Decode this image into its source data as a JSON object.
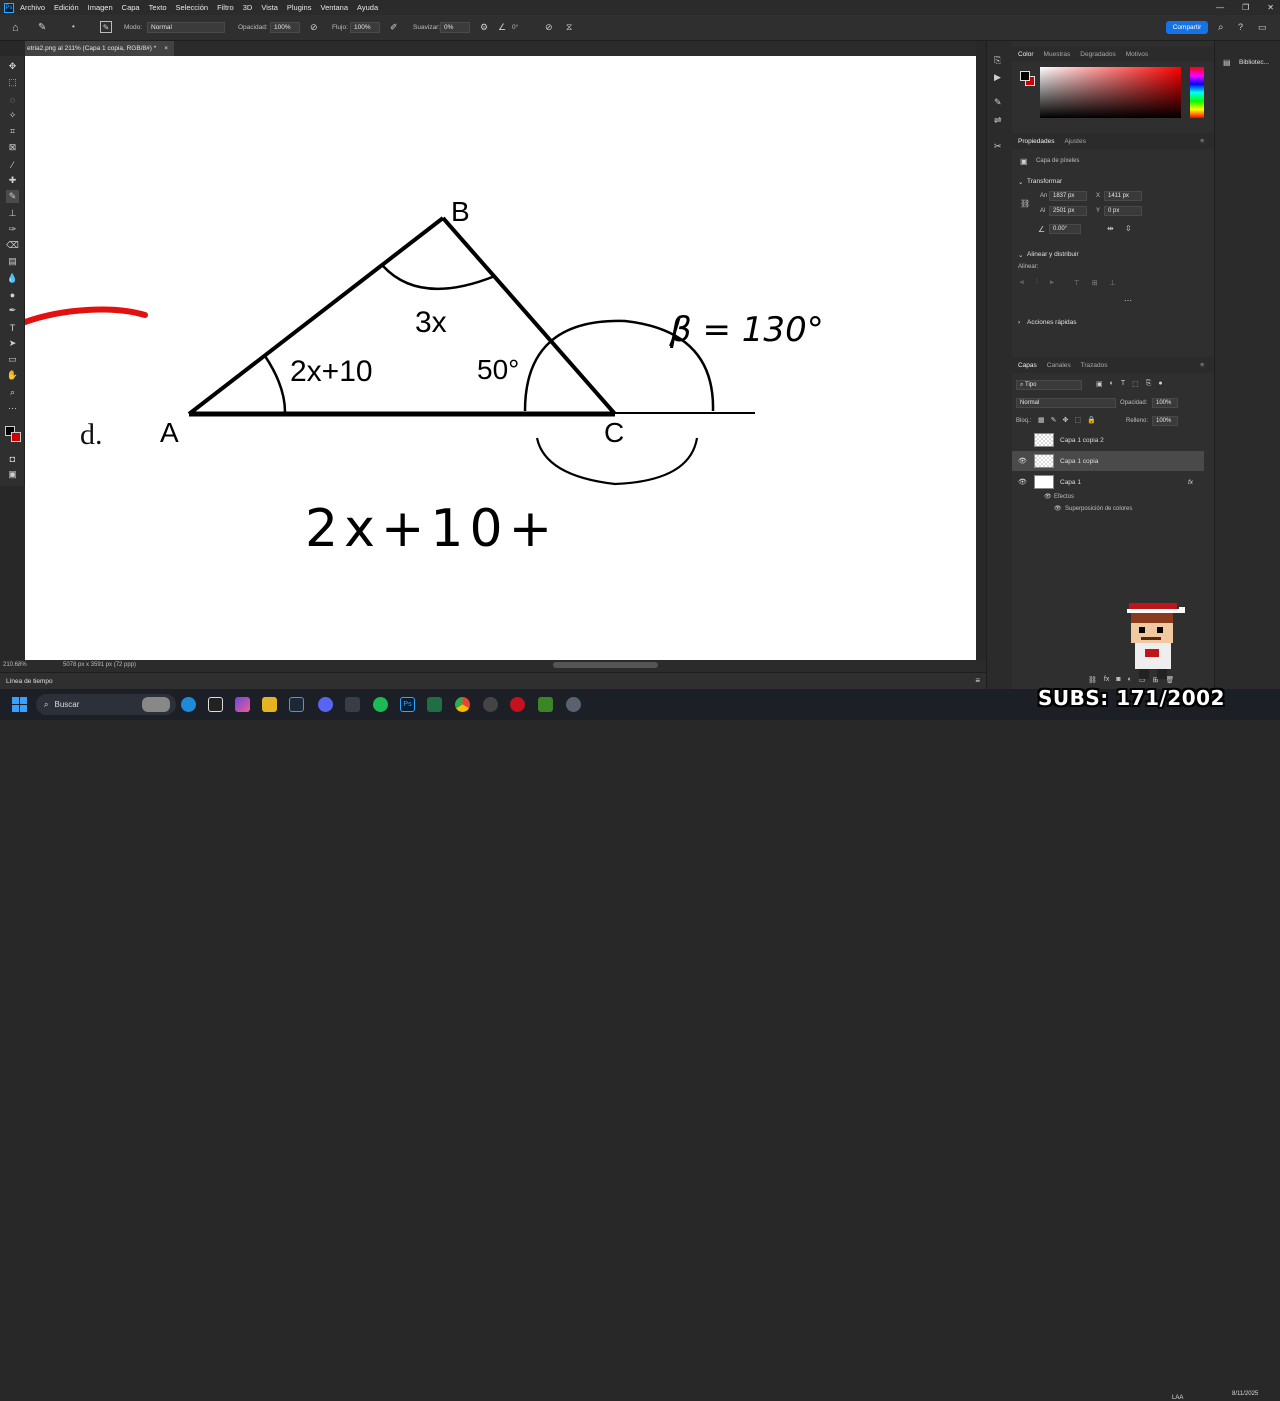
{
  "menubar": {
    "logo": "Ps",
    "items": [
      "Archivo",
      "Edición",
      "Imagen",
      "Capa",
      "Texto",
      "Selección",
      "Filtro",
      "3D",
      "Vista",
      "Plugins",
      "Ventana",
      "Ayuda"
    ]
  },
  "options": {
    "mode_label": "Modo:",
    "mode_value": "Normal",
    "opacity_label": "Opacidad:",
    "opacity_value": "100%",
    "flow_label": "Flujo:",
    "flow_value": "100%",
    "smooth_label": "Suavizar:",
    "smooth_value": "0%",
    "angle_value": "0°",
    "share_label": "Compartir"
  },
  "document": {
    "tab_label": "etria2.png al 211% (Capa 1 copia, RGB/8#) *",
    "close": "×"
  },
  "drawing": {
    "label_d": "d.",
    "vertex_a": "A",
    "vertex_b": "B",
    "vertex_c": "C",
    "angle_a": "2x+10",
    "angle_b": "3x",
    "angle_c": "50°",
    "beta_note": "β = 130°",
    "equation": "2x+10+"
  },
  "status": {
    "zoom": "210.68%",
    "doc_size": "5078 px x 3591 px (72 ppp)"
  },
  "timeline_label": "Línea de tiempo",
  "color_panel": {
    "tabs": [
      "Color",
      "Muestras",
      "Degradados",
      "Motivos"
    ],
    "foreground": "#000000",
    "background": "#cc0000",
    "hue": "#ff0000"
  },
  "properties": {
    "tabs": [
      "Propiedades",
      "Ajustes"
    ],
    "kind": "Capa de píxeles",
    "transform_title": "Transformar",
    "w_label": "An",
    "w_value": "1837 px",
    "x_label": "X",
    "x_value": "1411 px",
    "h_label": "Al",
    "h_value": "2501 px",
    "y_label": "Y",
    "y_value": "0 px",
    "angle_value": "0.00°",
    "align_title": "Alinear y distribuir",
    "align_label": "Alinear:",
    "quick_title": "Acciones rápidas"
  },
  "layers": {
    "tabs": [
      "Capas",
      "Canales",
      "Trazados"
    ],
    "filter_label": "Tipo",
    "blend_mode": "Normal",
    "opacity_label": "Opacidad:",
    "opacity_value": "100%",
    "lock_label": "Bloq.:",
    "fill_label": "Relleno:",
    "fill_value": "100%",
    "rows": [
      {
        "name": "Capa 1 copia 2",
        "visible": false,
        "selected": false
      },
      {
        "name": "Capa 1 copia",
        "visible": true,
        "selected": true
      },
      {
        "name": "Capa 1",
        "visible": true,
        "selected": false,
        "fx": "fx"
      }
    ],
    "effects_label": "Efectos",
    "effect_name": "Superposición de colores"
  },
  "library": {
    "label": "Bibliotec..."
  },
  "taskbar": {
    "search_placeholder": "Buscar",
    "lang": "LAA",
    "time": "",
    "date": "8/11/2025"
  },
  "overlay": {
    "subs_text": "SUBS: 171/2002"
  }
}
